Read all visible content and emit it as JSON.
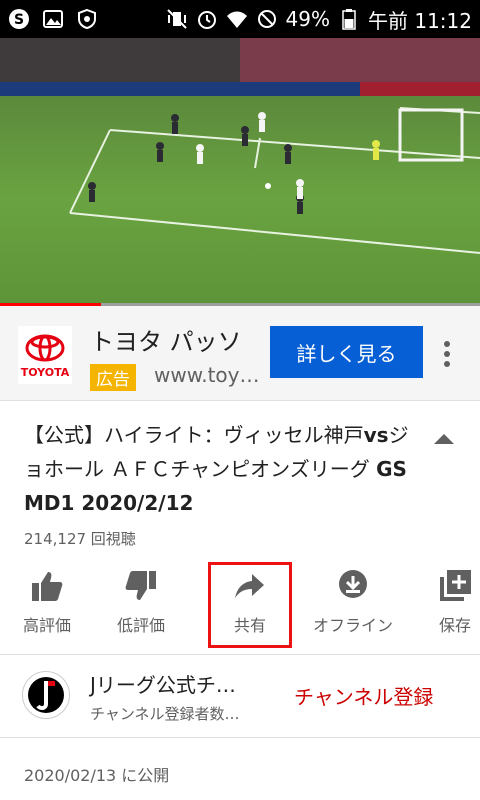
{
  "status_bar": {
    "battery": "49%",
    "time": "午前 11:12"
  },
  "video": {
    "progress_fraction": 0.21
  },
  "ad": {
    "title": "トヨタ パッソ",
    "badge": "広告",
    "url": "www.toy…",
    "cta": "詳しく見る",
    "logo_text": "TOYOTA"
  },
  "video_info": {
    "title_part1": "【公式】ハイライト：ヴィッセル神戸",
    "title_part2": "vs",
    "title_part3": "ジョホール ＡＦＣチャンピオンズリーグ ",
    "title_part4": "GS MD1 2020/2/12",
    "views": "214,127 回視聴"
  },
  "actions": {
    "like": "高評価",
    "dislike": "低評価",
    "share": "共有",
    "offline": "オフライン",
    "save": "保存"
  },
  "channel": {
    "name": "Jリーグ公式チ…",
    "subscribers": "チャンネル登録者数…",
    "subscribe": "チャンネル登録"
  },
  "published": "2020/02/13 に公開",
  "colors": {
    "accent_blue": "#065fd4",
    "subscribe_red": "#cc0000",
    "ad_badge": "#f4b400"
  }
}
